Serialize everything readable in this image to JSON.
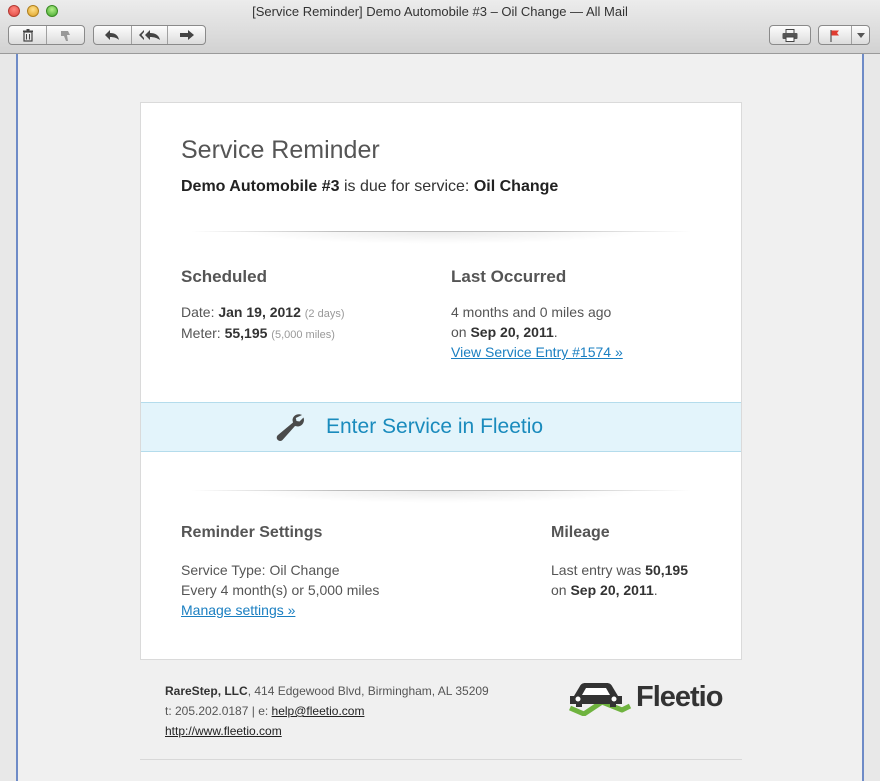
{
  "window": {
    "title": "[Service Reminder] Demo Automobile #3 – Oil Change — All Mail"
  },
  "toolbar": {
    "icons": [
      "trash-icon",
      "junk-icon",
      "reply-icon",
      "reply-all-icon",
      "forward-icon",
      "print-icon",
      "flag-icon",
      "dropdown-arrow-icon"
    ]
  },
  "email": {
    "heading": "Service Reminder",
    "vehicle": "Demo Automobile #3",
    "due_text": " is due for service: ",
    "service": "Oil Change",
    "scheduled": {
      "heading": "Scheduled",
      "date_label": "Date: ",
      "date_value": "Jan 19, 2012",
      "date_note": "(2 days)",
      "meter_label": "Meter: ",
      "meter_value": "55,195",
      "meter_note": "(5,000 miles)"
    },
    "last_occurred": {
      "heading": "Last Occurred",
      "ago_text": "4 months and 0 miles ago",
      "on_label": "on ",
      "on_date": "Sep 20, 2011",
      "period": ".",
      "link": "View Service Entry #1574 »"
    },
    "cta": {
      "label": "Enter Service in Fleetio"
    },
    "reminder_settings": {
      "heading": "Reminder Settings",
      "service_type": "Service Type: Oil Change",
      "frequency": "Every 4 month(s) or 5,000 miles",
      "link": "Manage settings »"
    },
    "mileage": {
      "heading": "Mileage",
      "last_entry_label": "Last entry was ",
      "last_entry_value": "50,195",
      "on_label": "on ",
      "on_date": "Sep 20, 2011",
      "period": "."
    }
  },
  "footer": {
    "company": "RareStep, LLC",
    "address": ", 414 Edgewood Blvd, Birmingham, AL 35209",
    "phone_text": "t: 205.202.0187 | e: ",
    "email": "help@fleetio.com",
    "website": "http://www.fleetio.com",
    "logo_text": "Fleetio"
  },
  "colors": {
    "accent": "#1a8bbd",
    "link": "#1a7fc1",
    "cta_background": "#e3f4fb",
    "logo_green": "#6fb33f"
  }
}
